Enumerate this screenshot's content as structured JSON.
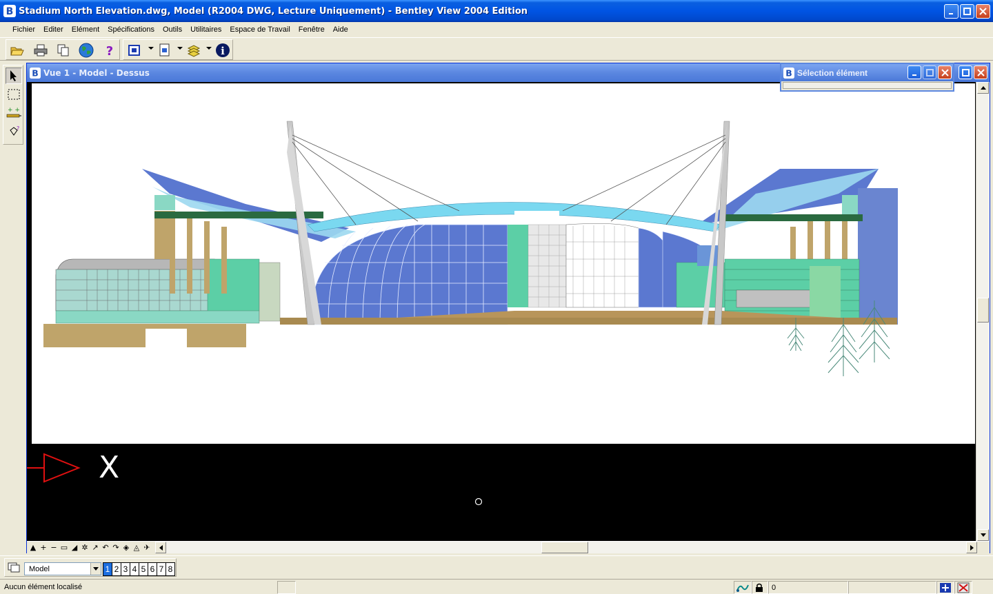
{
  "window": {
    "title": "Stadium North Elevation.dwg, Model (R2004 DWG, Lecture Uniquement) - Bentley View 2004 Edition"
  },
  "menu": {
    "items": [
      {
        "label": "Fichier"
      },
      {
        "label": "Editer"
      },
      {
        "label": "Elément"
      },
      {
        "label": "Spécifications"
      },
      {
        "label": "Outils"
      },
      {
        "label": "Utilitaires"
      },
      {
        "label": "Espace de Travail"
      },
      {
        "label": "Fenêtre"
      },
      {
        "label": "Aide"
      }
    ]
  },
  "toolbar": {
    "icons": [
      "open-icon",
      "print-icon",
      "copy-icon",
      "globe-icon",
      "help-icon",
      "view-icon",
      "reference-icon",
      "levels-icon",
      "info-icon"
    ]
  },
  "view": {
    "title": "Vue 1 - Model - Dessus",
    "axis_label": "X"
  },
  "selection_dialog": {
    "title": "Sélection élément"
  },
  "model_bar": {
    "selected_model": "Model",
    "views": [
      "1",
      "2",
      "3",
      "4",
      "5",
      "6",
      "7",
      "8"
    ],
    "active_view": "1"
  },
  "status": {
    "message": "Aucun élément localisé",
    "level": "0"
  },
  "colors": {
    "titlebar_blue": "#0054e3",
    "inactive_title": "#5b87e0",
    "roof_blue": "#5b78d0",
    "glass_cyan": "#7ad8f0",
    "facade_teal": "#5ccfa6",
    "tan": "#bfa46a"
  }
}
